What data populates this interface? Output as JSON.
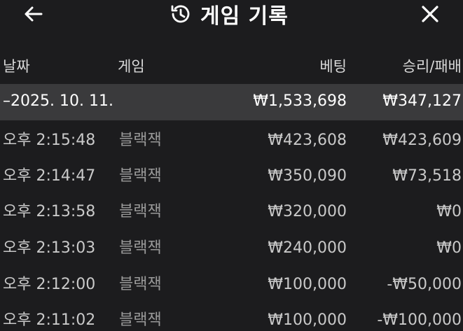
{
  "header": {
    "title": "게임 기록",
    "back_icon": "arrow-left-icon",
    "history_icon": "history-icon",
    "close_icon": "close-icon"
  },
  "columns": {
    "date": "날짜",
    "game": "게임",
    "bet": "베팅",
    "result": "승리/패배"
  },
  "group": {
    "date": "–2025. 10. 11.",
    "bet_total": "₩1,533,698",
    "result_total": "₩347,127"
  },
  "rows": [
    {
      "time": "오후 2:15:48",
      "game": "블랙잭",
      "bet": "₩423,608",
      "result": "₩423,609"
    },
    {
      "time": "오후 2:14:47",
      "game": "블랙잭",
      "bet": "₩350,090",
      "result": "₩73,518"
    },
    {
      "time": "오후 2:13:58",
      "game": "블랙잭",
      "bet": "₩320,000",
      "result": "₩0"
    },
    {
      "time": "오후 2:13:03",
      "game": "블랙잭",
      "bet": "₩240,000",
      "result": "₩0"
    },
    {
      "time": "오후 2:12:00",
      "game": "블랙잭",
      "bet": "₩100,000",
      "result": "-₩50,000"
    },
    {
      "time": "오후 2:11:02",
      "game": "블랙잭",
      "bet": "₩100,000",
      "result": "-₩100,000"
    }
  ],
  "colors": {
    "background": "#1c1c1e",
    "group_background": "#3a3a3c",
    "text_primary": "#ffffff",
    "text_secondary": "#c9c9c9",
    "text_muted": "#9a9a9a"
  }
}
